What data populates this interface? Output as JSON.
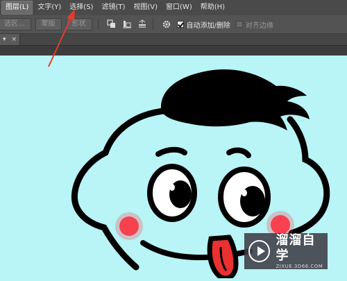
{
  "menu": {
    "items": [
      {
        "label": "图层(L)",
        "active": true
      },
      {
        "label": "文字(Y)"
      },
      {
        "label": "选择(S)"
      },
      {
        "label": "滤镜(T)"
      },
      {
        "label": "视图(V)"
      },
      {
        "label": "窗口(W)"
      },
      {
        "label": "帮助(H)"
      }
    ]
  },
  "options": {
    "select_area": "选区...",
    "mask": "蒙版",
    "shape": "形状",
    "auto_add_delete": "自动添加/删除",
    "align_edges": "对齐边缘",
    "auto_add_checked": true,
    "align_checked": false
  },
  "tab": {
    "arrow": "▾",
    "close": "×"
  },
  "watermark": {
    "title": "溜溜自学",
    "subtitle": "ZIXUE.3D66.COM"
  },
  "colors": {
    "canvas": "#b9f4f6",
    "arrow": "#e23b2e",
    "cheek": "#ff2a3a",
    "tongue": "#ea3030"
  }
}
